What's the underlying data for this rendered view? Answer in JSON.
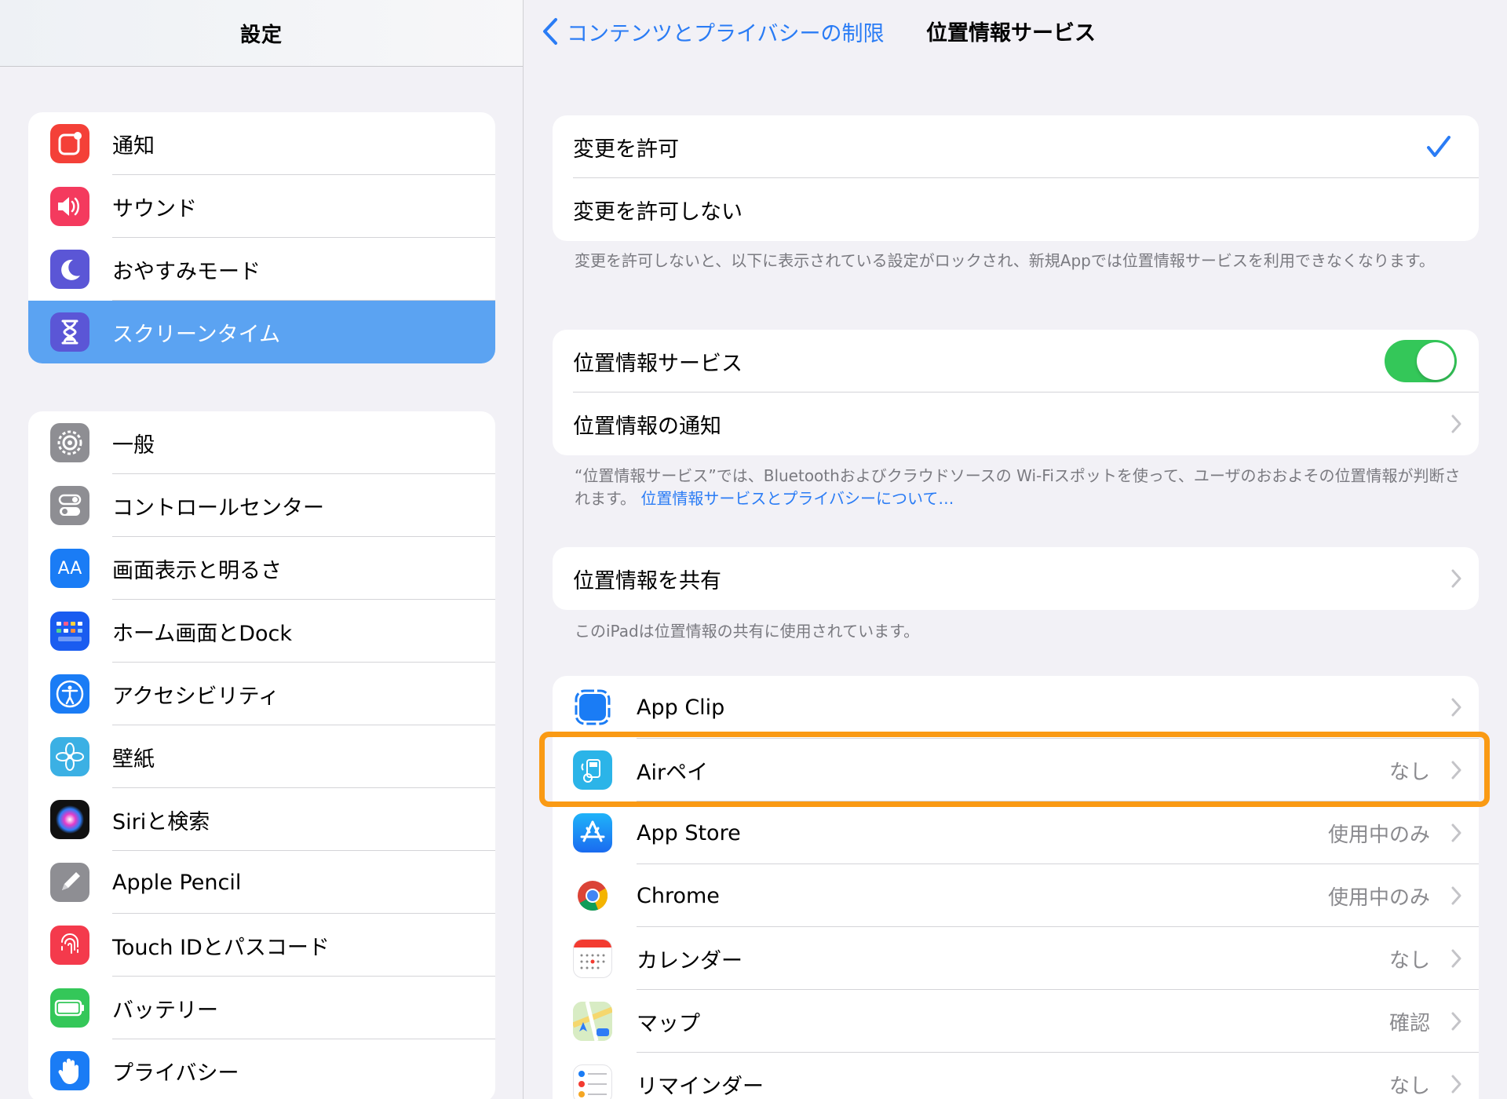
{
  "sidebar": {
    "title": "設定",
    "group1": [
      {
        "label": "通知",
        "icon": "notifications-icon",
        "color": "#f44038"
      },
      {
        "label": "サウンド",
        "icon": "speaker-icon",
        "color": "#f43a5e"
      },
      {
        "label": "おやすみモード",
        "icon": "moon-icon",
        "color": "#5b56d6"
      },
      {
        "label": "スクリーンタイム",
        "icon": "hourglass-icon",
        "color": "#5b56d6",
        "selected": true
      }
    ],
    "group2": [
      {
        "label": "一般",
        "icon": "gear-icon",
        "color": "#8e8e93"
      },
      {
        "label": "コントロールセンター",
        "icon": "toggles-icon",
        "color": "#8e8e93"
      },
      {
        "label": "画面表示と明るさ",
        "icon": "text-size-icon",
        "color": "#1a7cf5",
        "glyph": "AA"
      },
      {
        "label": "ホーム画面とDock",
        "icon": "home-grid-icon",
        "color": "#1a5cf0"
      },
      {
        "label": "アクセシビリティ",
        "icon": "accessibility-icon",
        "color": "#1a7cf5"
      },
      {
        "label": "壁紙",
        "icon": "flower-icon",
        "color": "#3bb0e4"
      },
      {
        "label": "Siriと検索",
        "icon": "siri-icon",
        "color": "#111111"
      },
      {
        "label": "Apple Pencil",
        "icon": "pencil-icon",
        "color": "#8e8e93"
      },
      {
        "label": "Touch IDとパスコード",
        "icon": "fingerprint-icon",
        "color": "#f43a4c"
      },
      {
        "label": "バッテリー",
        "icon": "battery-icon",
        "color": "#34c759"
      },
      {
        "label": "プライバシー",
        "icon": "hand-icon",
        "color": "#1a7cf5"
      }
    ]
  },
  "nav": {
    "back_label": "コンテンツとプライバシーの制限",
    "title": "位置情報サービス"
  },
  "allow": {
    "allow_label": "変更を許可",
    "deny_label": "変更を許可しない",
    "selected": "allow",
    "note": "変更を許可しないと、以下に表示されている設定がロックされ、新規Appでは位置情報サービスを利用できなくなります。"
  },
  "location": {
    "service_label": "位置情報サービス",
    "service_on": true,
    "alerts_label": "位置情報の通知",
    "note_text": "“位置情報サービス”では、Bluetoothおよびクラウドソースの Wi-Fiスポットを使って、ユーザのおおよその位置情報が判断されます。",
    "note_link": "位置情報サービスとプライバシーについて…"
  },
  "share": {
    "label": "位置情報を共有",
    "note": "このiPadは位置情報の共有に使用されています。"
  },
  "apps": [
    {
      "name": "App Clip",
      "value": "",
      "icon": "app-clip-icon"
    },
    {
      "name": "Airペイ",
      "value": "なし",
      "icon": "airpay-icon",
      "highlighted": true
    },
    {
      "name": "App Store",
      "value": "使用中のみ",
      "icon": "app-store-icon"
    },
    {
      "name": "Chrome",
      "value": "使用中のみ",
      "icon": "chrome-icon"
    },
    {
      "name": "カレンダー",
      "value": "なし",
      "icon": "calendar-icon"
    },
    {
      "name": "マップ",
      "value": "確認",
      "icon": "maps-icon"
    },
    {
      "name": "リマインダー",
      "value": "なし",
      "icon": "reminders-icon"
    }
  ],
  "colors": {
    "accent": "#2a7cf5",
    "selected_row": "#5ba3f2",
    "toggle_on": "#34c759",
    "highlight": "#fa9a14"
  }
}
